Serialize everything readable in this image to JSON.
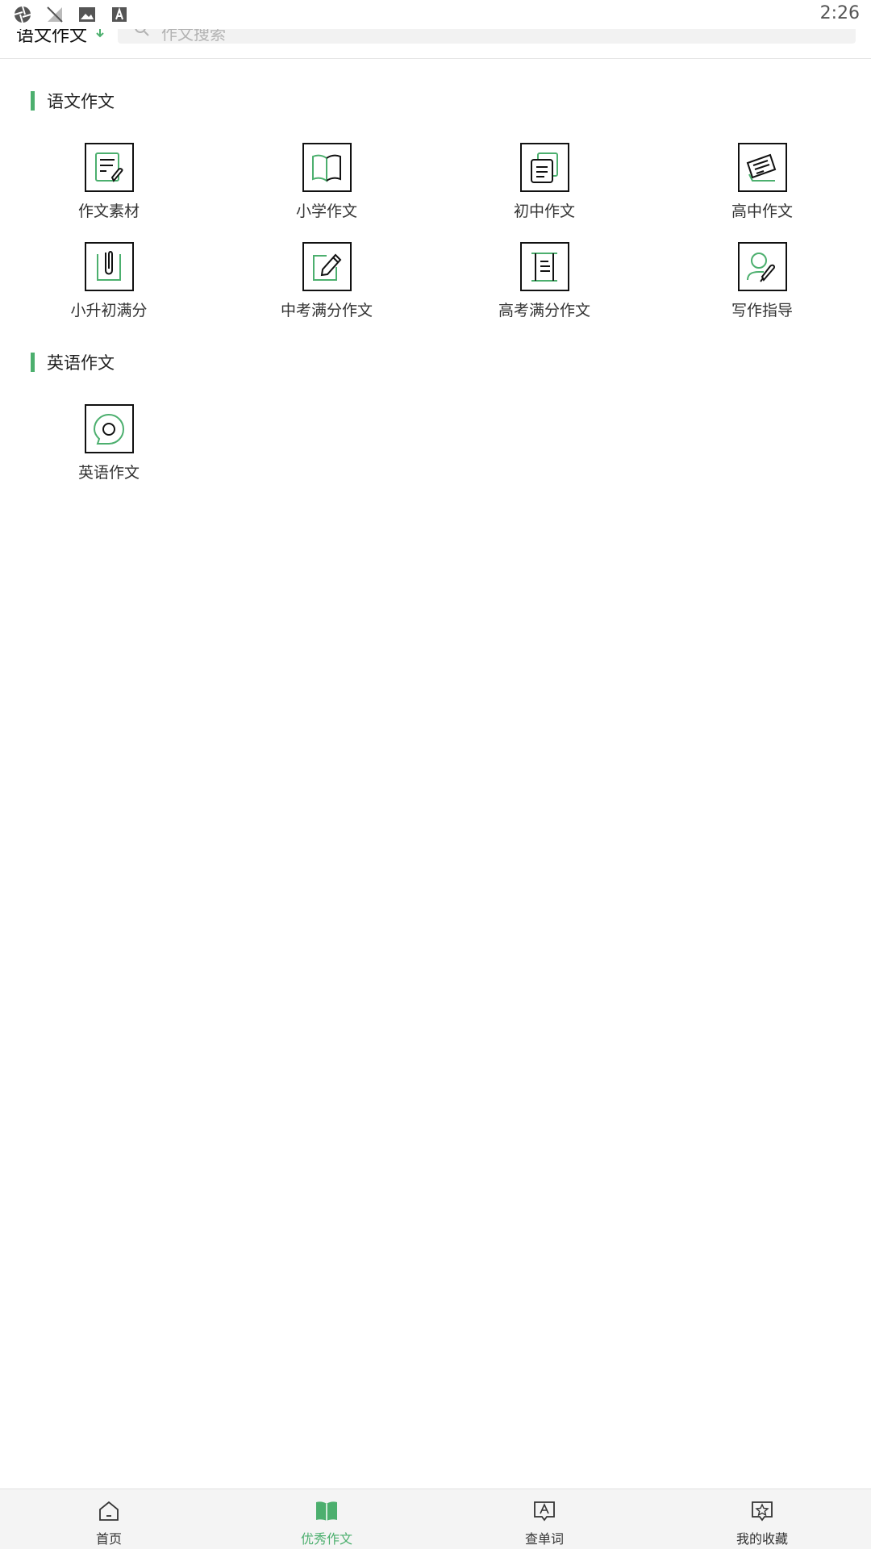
{
  "status_bar": {
    "time": "2:26",
    "icons": [
      "aperture-icon",
      "no-signal-icon",
      "image-icon",
      "font-a-icon"
    ]
  },
  "header": {
    "title": "语文作文",
    "search_placeholder": "作文搜索"
  },
  "sections": [
    {
      "title": "语文作文",
      "items": [
        {
          "label": "作文素材",
          "icon": "document-pen-icon"
        },
        {
          "label": "小学作文",
          "icon": "open-book-icon"
        },
        {
          "label": "初中作文",
          "icon": "stacked-docs-icon"
        },
        {
          "label": "高中作文",
          "icon": "tilted-note-icon"
        },
        {
          "label": "小升初满分",
          "icon": "paperclip-icon"
        },
        {
          "label": "中考满分作文",
          "icon": "edit-pencil-icon"
        },
        {
          "label": "高考满分作文",
          "icon": "scroll-icon"
        },
        {
          "label": "写作指导",
          "icon": "user-pen-icon"
        }
      ]
    },
    {
      "title": "英语作文",
      "items": [
        {
          "label": "英语作文",
          "icon": "chat-bubble-icon"
        }
      ]
    }
  ],
  "bottom_nav": [
    {
      "label": "首页",
      "icon": "home-icon",
      "active": false
    },
    {
      "label": "优秀作文",
      "icon": "book-icon",
      "active": true
    },
    {
      "label": "查单词",
      "icon": "dictionary-icon",
      "active": false
    },
    {
      "label": "我的收藏",
      "icon": "star-icon",
      "active": false
    }
  ],
  "colors": {
    "accent": "#4caf6e",
    "text": "#333333",
    "nav_bg": "#f4f4f4"
  }
}
